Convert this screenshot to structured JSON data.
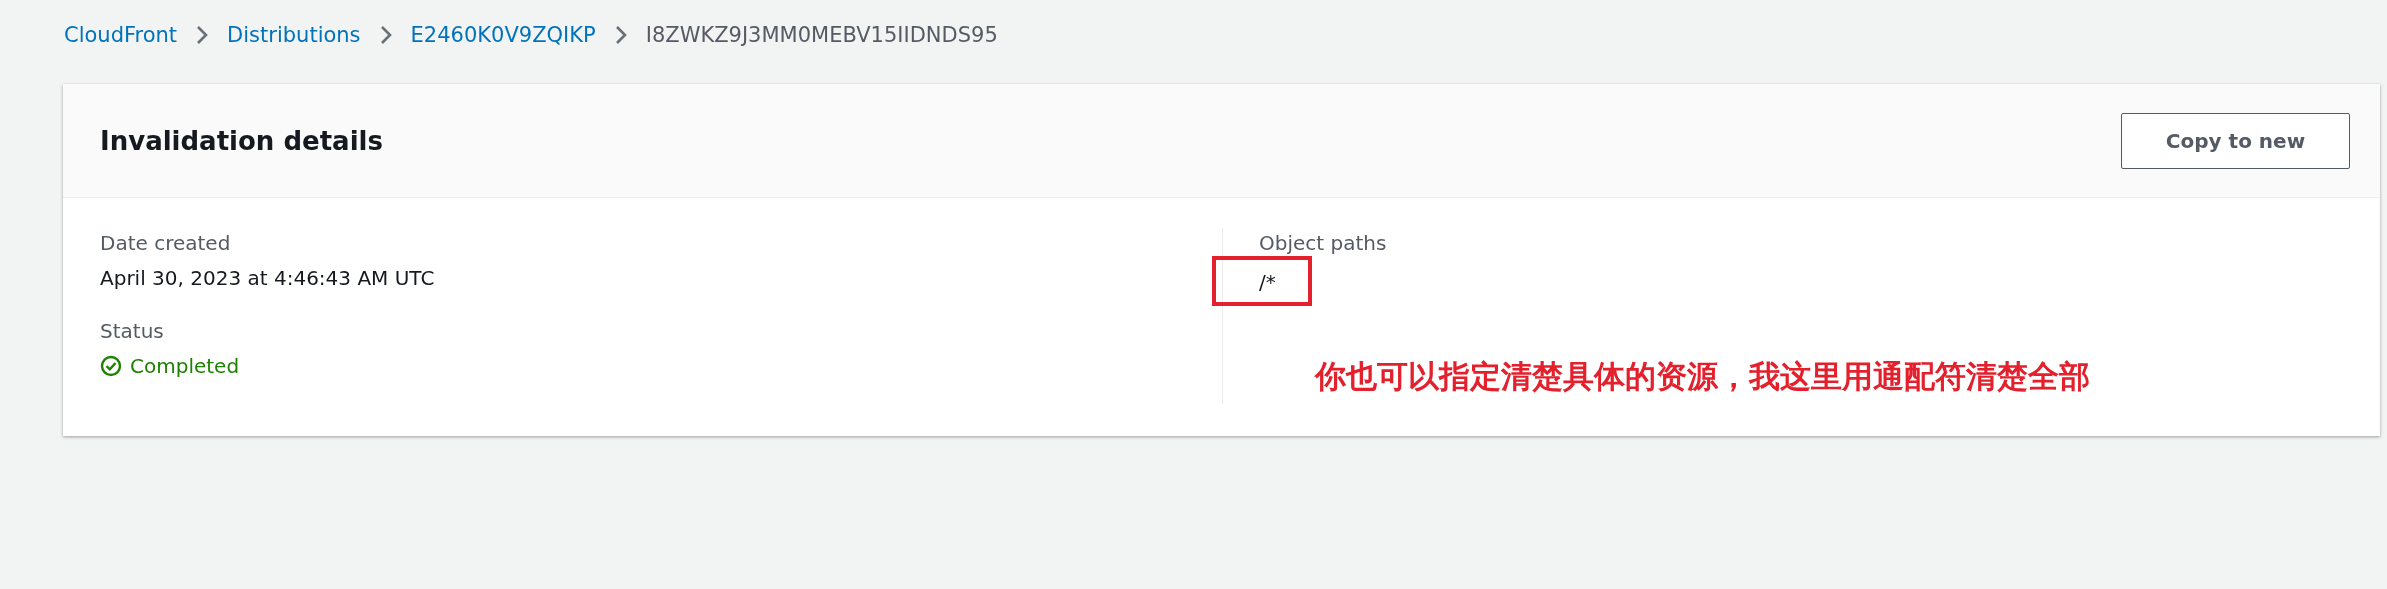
{
  "breadcrumbs": [
    {
      "label": "CloudFront",
      "kind": "link"
    },
    {
      "label": "Distributions",
      "kind": "link"
    },
    {
      "label": "E2460K0V9ZQIKP",
      "kind": "link"
    },
    {
      "label": "I8ZWKZ9J3MM0MEBV15IIDNDS95",
      "kind": "current"
    }
  ],
  "panel": {
    "title": "Invalidation details",
    "button": "Copy to new",
    "fields": [
      {
        "label": "Date created",
        "value": "April 30, 2023 at 4:46:43 AM UTC",
        "kind": "text"
      },
      {
        "label": "Status",
        "value": "Completed",
        "kind": "success"
      }
    ],
    "object_paths": {
      "label": "Object paths",
      "paths": [
        "/*"
      ]
    }
  },
  "annotation": {
    "text": "你也可以指定清楚具体的资源，我这里用通配符清楚全部"
  }
}
